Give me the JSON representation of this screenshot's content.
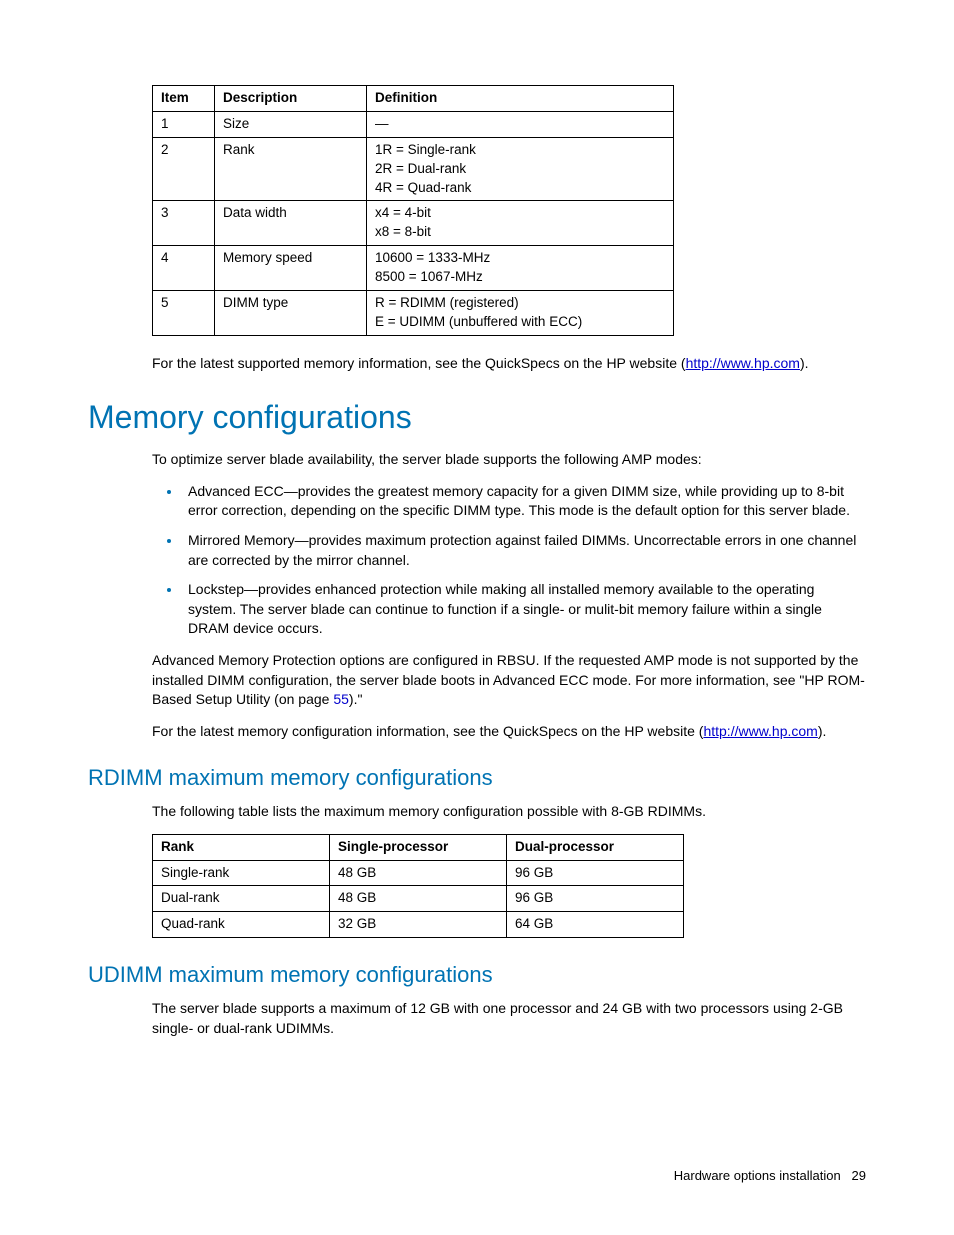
{
  "table1": {
    "headers": [
      "Item",
      "Description",
      "Definition"
    ],
    "rows": [
      {
        "item": "1",
        "desc": "Size",
        "def": "—"
      },
      {
        "item": "2",
        "desc": "Rank",
        "def": "1R = Single-rank\n2R = Dual-rank\n4R = Quad-rank"
      },
      {
        "item": "3",
        "desc": "Data width",
        "def": "x4 = 4-bit\nx8 = 8-bit"
      },
      {
        "item": "4",
        "desc": "Memory speed",
        "def": "10600 = 1333-MHz\n8500 = 1067-MHz"
      },
      {
        "item": "5",
        "desc": "DIMM type",
        "def": "R = RDIMM (registered)\nE = UDIMM (unbuffered with ECC)"
      }
    ]
  },
  "para1_pre": "For the latest supported memory information, see the QuickSpecs on the HP website (",
  "para1_link": "http://www.hp.com",
  "para1_post": ").",
  "h1": "Memory configurations",
  "para2": "To optimize server blade availability, the server blade supports the following AMP modes:",
  "bullets": [
    "Advanced ECC—provides the greatest memory capacity for a given DIMM size, while providing up to 8-bit error correction, depending on the specific DIMM type. This mode is the default option for this server blade.",
    "Mirrored Memory—provides maximum protection against failed DIMMs. Uncorrectable errors in one channel are corrected by the mirror channel.",
    "Lockstep—provides enhanced protection while making all installed memory available to the operating system. The server blade can continue to function if a single- or mulit-bit memory failure within a single DRAM device occurs."
  ],
  "para3_pre": "Advanced Memory Protection options are configured in RBSU. If the requested AMP mode is not supported by the installed DIMM configuration, the server blade boots in Advanced ECC mode. For more information, see \"HP ROM-Based Setup Utility (on page ",
  "para3_page": "55",
  "para3_post": ").\"",
  "para4_pre": "For the latest memory configuration information, see the QuickSpecs on the HP website (",
  "para4_link": "http://www.hp.com",
  "para4_post": ").",
  "h2a": "RDIMM maximum memory configurations",
  "para5": "The following table lists the maximum memory configuration possible with 8-GB RDIMMs.",
  "table2": {
    "headers": [
      "Rank",
      "Single-processor",
      "Dual-processor"
    ],
    "rows": [
      {
        "rank": "Single-rank",
        "sp": "48 GB",
        "dp": "96 GB"
      },
      {
        "rank": "Dual-rank",
        "sp": "48 GB",
        "dp": "96 GB"
      },
      {
        "rank": "Quad-rank",
        "sp": "32 GB",
        "dp": "64 GB"
      }
    ]
  },
  "h2b": "UDIMM maximum memory configurations",
  "para6": "The server blade supports a maximum of 12 GB with one processor and 24 GB with two processors using 2-GB single- or dual-rank UDIMMs.",
  "footer_label": "Hardware options installation",
  "footer_page": "29",
  "chart_data": [
    {
      "type": "table",
      "title": "DIMM identifier key",
      "columns": [
        "Item",
        "Description",
        "Definition"
      ],
      "rows": [
        [
          "1",
          "Size",
          "—"
        ],
        [
          "2",
          "Rank",
          "1R = Single-rank; 2R = Dual-rank; 4R = Quad-rank"
        ],
        [
          "3",
          "Data width",
          "x4 = 4-bit; x8 = 8-bit"
        ],
        [
          "4",
          "Memory speed",
          "10600 = 1333-MHz; 8500 = 1067-MHz"
        ],
        [
          "5",
          "DIMM type",
          "R = RDIMM (registered); E = UDIMM (unbuffered with ECC)"
        ]
      ]
    },
    {
      "type": "table",
      "title": "RDIMM maximum memory configurations (8-GB RDIMMs)",
      "columns": [
        "Rank",
        "Single-processor",
        "Dual-processor"
      ],
      "rows": [
        [
          "Single-rank",
          "48 GB",
          "96 GB"
        ],
        [
          "Dual-rank",
          "48 GB",
          "96 GB"
        ],
        [
          "Quad-rank",
          "32 GB",
          "64 GB"
        ]
      ]
    }
  ]
}
